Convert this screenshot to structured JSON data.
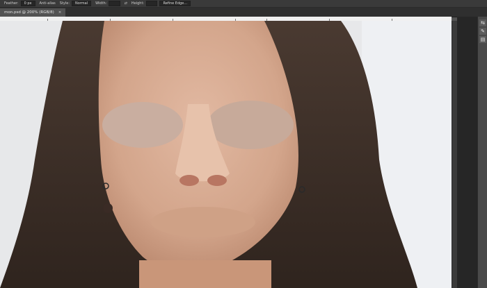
{
  "options": {
    "feather_label": "Feather:",
    "feather_value": "0 px",
    "antialias_label": "Anti-alias",
    "style_label": "Style:",
    "style_value": "Normal",
    "width_label": "Width:",
    "height_label": "Height:",
    "refine_label": "Refine Edge..."
  },
  "document": {
    "tab_label": "mon.psd @ 200% (RGB/8)",
    "close_glyph": "×"
  },
  "panel": {
    "icon1": "⇆",
    "icon2": "✎",
    "icon3": "▤"
  }
}
